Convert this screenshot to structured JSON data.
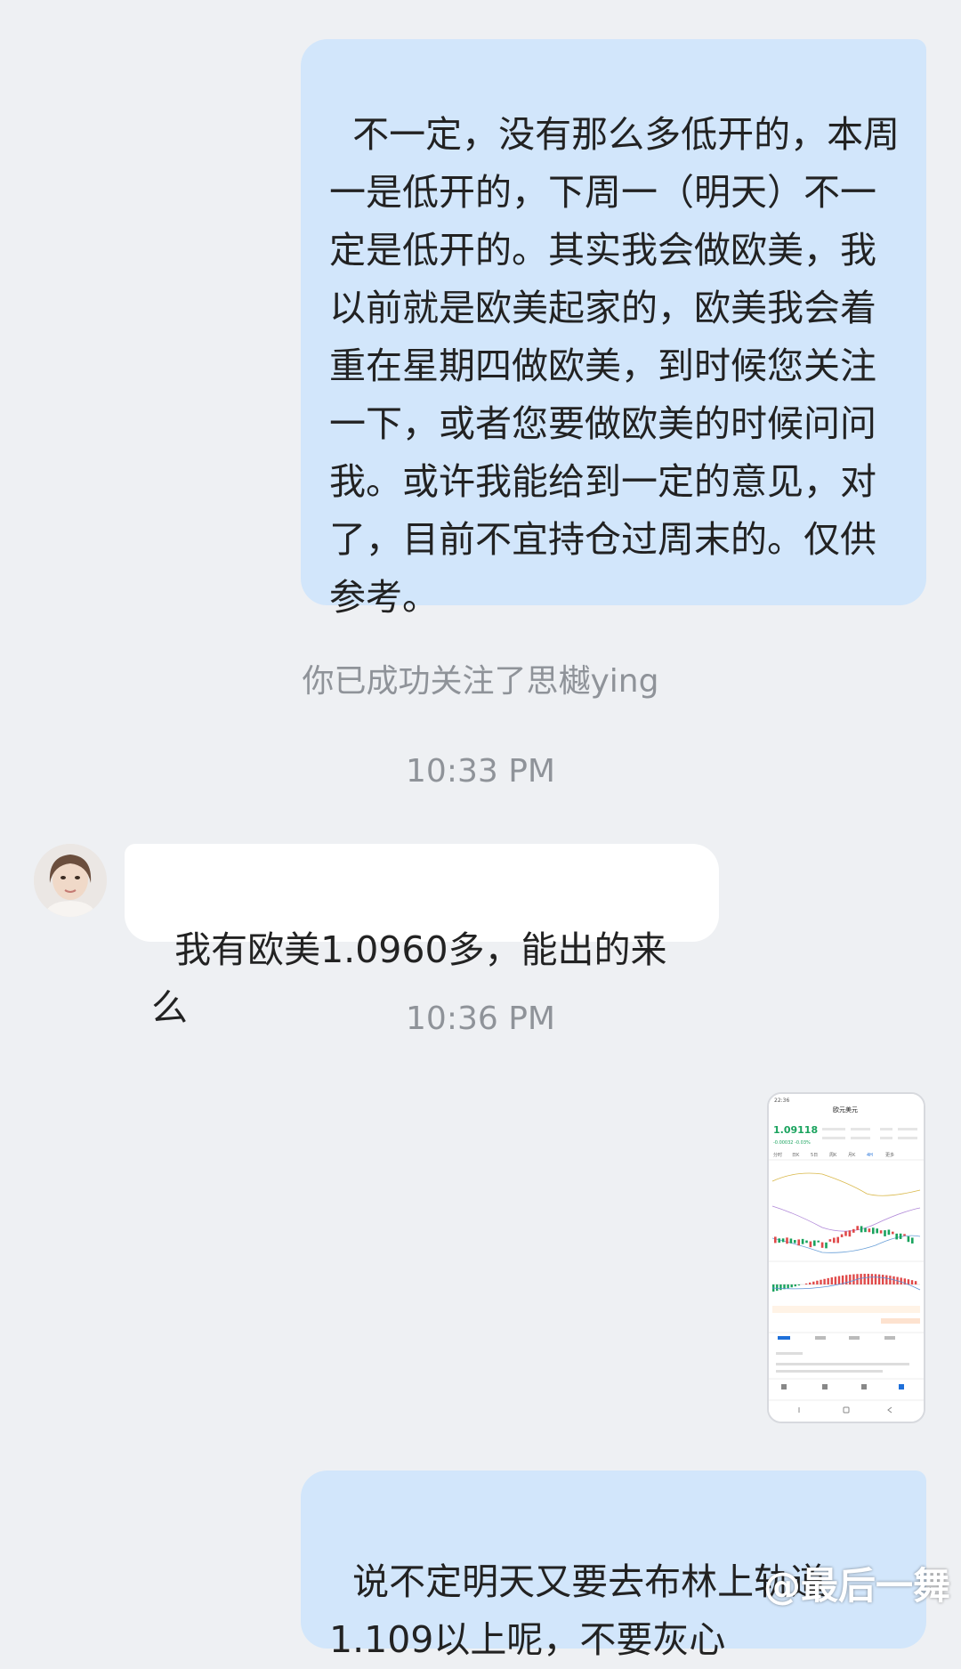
{
  "messages": {
    "m1_text": "不一定，没有那么多低开的，本周一是低开的，下周一（明天）不一定是低开的。其实我会做欧美，我以前就是欧美起家的，欧美我会着重在星期四做欧美，到时候您关注一下，或者您要做欧美的时候问问我。或许我能给到一定的意见，对了，目前不宜持仓过周末的。仅供参考。",
    "system_follow": "你已成功关注了思樾ying",
    "time1": "10:33 PM",
    "m2_text": "我有欧美1.0960多，能出的来么",
    "time2": "10:36 PM",
    "m4_text": "说不定明天又要去布林上轨道\n1.109以上呢，不要灰心"
  },
  "screenshot": {
    "status_time": "22:36",
    "title": "欧元美元",
    "price": "1.09118",
    "change": "-0.00032 -0.03%",
    "tabs": [
      "分时",
      "日K",
      "5日",
      "周K",
      "月K",
      "4H",
      "更多"
    ],
    "colors": {
      "up": "#1aa35e",
      "down": "#e04a4a",
      "blue": "#1e6fd9"
    }
  },
  "watermark": "@最后一舞"
}
